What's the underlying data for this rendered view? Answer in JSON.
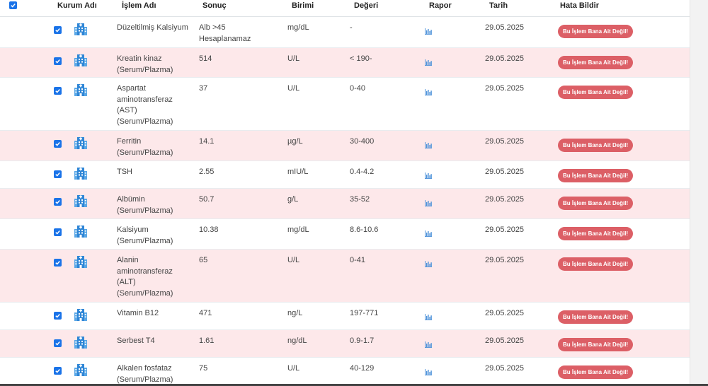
{
  "columns": {
    "kurum": "Kurum Adı",
    "islem": "İşlem Adı",
    "sonuc": "Sonuç",
    "birimi": "Birimi",
    "degeri": "Değeri",
    "rapor": "Rapor",
    "tarih": "Tarih",
    "hata": "Hata Bildir"
  },
  "rows": [
    {
      "islem": [
        "Düzeltilmiş Kalsiyum"
      ],
      "sonuc": [
        "Alb >45",
        "Hesaplanamaz"
      ],
      "birimi": "mg/dL",
      "degeri": "-",
      "tarih": "29.05.2025",
      "button": "Bu İşlem Bana Ait Değil!"
    },
    {
      "islem": [
        "Kreatin kinaz",
        "(Serum/Plazma)"
      ],
      "sonuc": [
        "514"
      ],
      "birimi": "U/L",
      "degeri": "< 190-",
      "tarih": "29.05.2025",
      "button": "Bu İşlem Bana Ait Değil!"
    },
    {
      "islem": [
        "Aspartat",
        "aminotransferaz",
        "(AST)",
        "(Serum/Plazma)"
      ],
      "sonuc": [
        "37"
      ],
      "birimi": "U/L",
      "degeri": "0-40",
      "tarih": "29.05.2025",
      "button": "Bu İşlem Bana Ait Değil!"
    },
    {
      "islem": [
        "Ferritin",
        "(Serum/Plazma)"
      ],
      "sonuc": [
        "14.1"
      ],
      "birimi": "µg/L",
      "degeri": "30-400",
      "tarih": "29.05.2025",
      "button": "Bu İşlem Bana Ait Değil!"
    },
    {
      "islem": [
        "TSH"
      ],
      "sonuc": [
        "2.55"
      ],
      "birimi": "mIU/L",
      "degeri": "0.4-4.2",
      "tarih": "29.05.2025",
      "button": "Bu İşlem Bana Ait Değil!"
    },
    {
      "islem": [
        "Albümin",
        "(Serum/Plazma)"
      ],
      "sonuc": [
        "50.7"
      ],
      "birimi": "g/L",
      "degeri": "35-52",
      "tarih": "29.05.2025",
      "button": "Bu İşlem Bana Ait Değil!"
    },
    {
      "islem": [
        "Kalsiyum",
        "(Serum/Plazma)"
      ],
      "sonuc": [
        "10.38"
      ],
      "birimi": "mg/dL",
      "degeri": "8.6-10.6",
      "tarih": "29.05.2025",
      "button": "Bu İşlem Bana Ait Değil!"
    },
    {
      "islem": [
        "Alanin",
        "aminotransferaz",
        "(ALT)",
        "(Serum/Plazma)"
      ],
      "sonuc": [
        "65"
      ],
      "birimi": "U/L",
      "degeri": "0-41",
      "tarih": "29.05.2025",
      "button": "Bu İşlem Bana Ait Değil!"
    },
    {
      "islem": [
        "Vitamin B12"
      ],
      "sonuc": [
        "471"
      ],
      "birimi": "ng/L",
      "degeri": "197-771",
      "tarih": "29.05.2025",
      "button": "Bu İşlem Bana Ait Değil!"
    },
    {
      "islem": [
        "Serbest T4"
      ],
      "sonuc": [
        "1.61"
      ],
      "birimi": "ng/dL",
      "degeri": "0.9-1.7",
      "tarih": "29.05.2025",
      "button": "Bu İşlem Bana Ait Değil!"
    },
    {
      "islem": [
        "Alkalen fosfataz",
        "(Serum/Plazma)"
      ],
      "sonuc": [
        "75"
      ],
      "birimi": "U/L",
      "degeri": "40-129",
      "tarih": "29.05.2025",
      "button": "Bu İşlem Bana Ait Değil!"
    }
  ],
  "icons": {
    "checkbox": "checkbox-checked-icon",
    "institution": "hospital-building-icon",
    "report": "bar-chart-icon"
  },
  "colors": {
    "accent": "#1a73e8",
    "row_highlight": "#fde8ea",
    "button": "#dc5f66"
  }
}
